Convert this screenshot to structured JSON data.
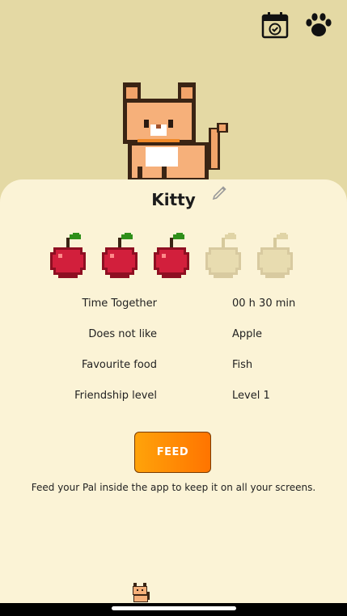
{
  "header": {
    "calendar_icon": "calendar-check-icon",
    "paw_icon": "paw-icon"
  },
  "pet": {
    "name": "Kitty"
  },
  "apples": {
    "filled": 3,
    "total": 5,
    "color_full": "#d21f3c",
    "color_empty": "#e8dcb0"
  },
  "stats": [
    {
      "label": "Time Together",
      "value": "00 h 30 min"
    },
    {
      "label": "Does not like",
      "value": "Apple"
    },
    {
      "label": "Favourite food",
      "value": "Fish"
    },
    {
      "label": "Friendship level",
      "value": "Level 1"
    }
  ],
  "feed": {
    "label": "FEED",
    "hint": "Feed your Pal inside the app to keep it on all your screens."
  },
  "colors": {
    "background": "#e4d9a4",
    "card": "#fbf3d6",
    "accent": "#ff8c00"
  }
}
